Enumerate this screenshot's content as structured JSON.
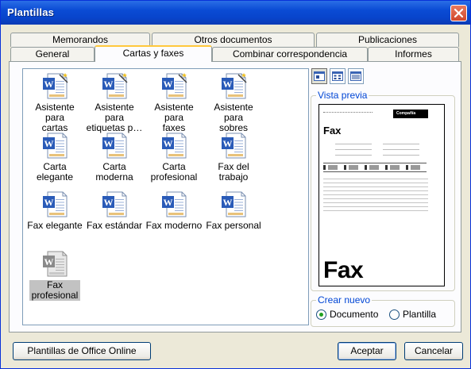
{
  "window": {
    "title": "Plantillas"
  },
  "tabs_row1": [
    {
      "label": "Memorandos"
    },
    {
      "label": "Otros documentos"
    },
    {
      "label": "Publicaciones"
    }
  ],
  "tabs_row2": [
    {
      "label": "General"
    },
    {
      "label": "Cartas y faxes"
    },
    {
      "label": "Combinar correspondencia"
    },
    {
      "label": "Informes"
    }
  ],
  "active_tab": "Cartas y faxes",
  "templates": [
    {
      "label": "Asistente para\ncartas",
      "type": "wizard"
    },
    {
      "label": "Asistente para\netiquetas p…",
      "type": "wizard"
    },
    {
      "label": "Asistente para\nfaxes",
      "type": "wizard"
    },
    {
      "label": "Asistente para\nsobres",
      "type": "wizard"
    },
    {
      "label": "Carta\nelegante",
      "type": "document"
    },
    {
      "label": "Carta\nmoderna",
      "type": "document"
    },
    {
      "label": "Carta\nprofesional",
      "type": "document"
    },
    {
      "label": "Fax del\ntrabajo",
      "type": "document"
    },
    {
      "label": "Fax elegante",
      "type": "document"
    },
    {
      "label": "Fax estándar",
      "type": "document"
    },
    {
      "label": "Fax moderno",
      "type": "document"
    },
    {
      "label": "Fax personal",
      "type": "document"
    },
    {
      "label": "Fax\nprofesional",
      "type": "document",
      "selected": true
    }
  ],
  "view_buttons": [
    {
      "icon": "large-icons-view-icon",
      "pressed": true
    },
    {
      "icon": "list-view-icon",
      "pressed": false
    },
    {
      "icon": "details-view-icon",
      "pressed": false
    }
  ],
  "preview": {
    "group_label": "Vista previa",
    "company_label": "Compañía",
    "heading": "Fax"
  },
  "create_new": {
    "group_label": "Crear nuevo",
    "options": [
      {
        "label": "Documento",
        "selected": true
      },
      {
        "label": "Plantilla",
        "selected": false
      }
    ]
  },
  "buttons": {
    "office_online": "Plantillas de Office Online",
    "accept": "Aceptar",
    "cancel": "Cancelar"
  },
  "colors": {
    "titlebar": "#0a4bd4",
    "close": "#d0472c",
    "active_tab_accent": "#ffc83c",
    "group_label": "#0046d5",
    "selection": "#c2c2c2"
  }
}
